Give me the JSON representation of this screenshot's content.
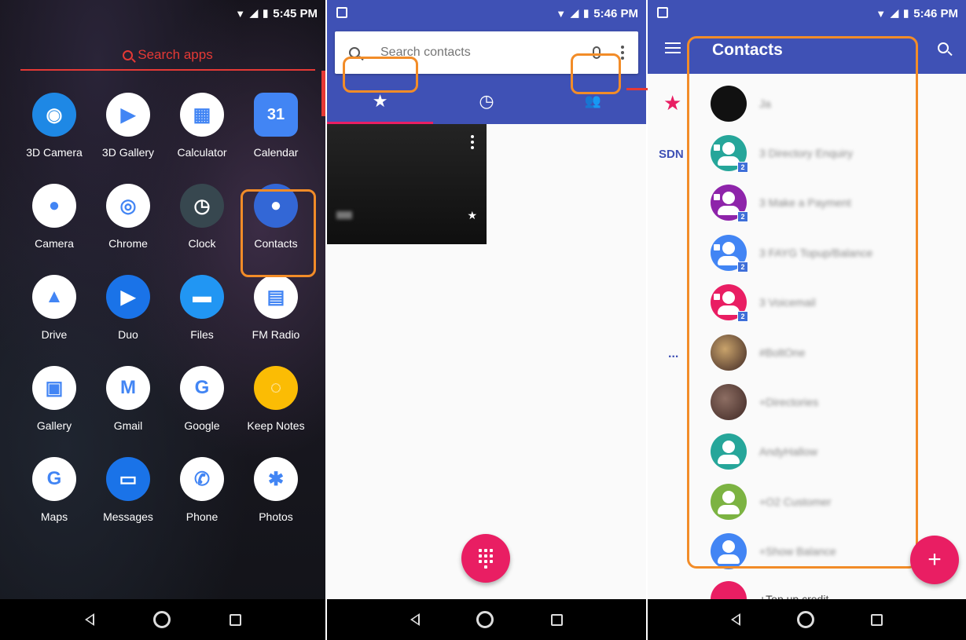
{
  "panel1": {
    "status_time": "5:45 PM",
    "search_label": "Search apps",
    "apps": [
      {
        "label": "3D Camera",
        "icon": "3d-camera-icon",
        "color": "#1e88e5",
        "glyph": "◉"
      },
      {
        "label": "3D Gallery",
        "icon": "3d-gallery-icon",
        "color": "#ffffff",
        "glyph": "▶"
      },
      {
        "label": "Calculator",
        "icon": "calculator-icon",
        "color": "#ffffff",
        "glyph": "▦"
      },
      {
        "label": "Calendar",
        "icon": "calendar-icon",
        "color": "#4285f4",
        "glyph": "31"
      },
      {
        "label": "Camera",
        "icon": "camera-icon",
        "color": "#ffffff",
        "glyph": "●"
      },
      {
        "label": "Chrome",
        "icon": "chrome-icon",
        "color": "#ffffff",
        "glyph": "◎"
      },
      {
        "label": "Clock",
        "icon": "clock-icon",
        "color": "#37474f",
        "glyph": "◷"
      },
      {
        "label": "Contacts",
        "icon": "contacts-icon",
        "color": "#3367d6",
        "glyph": "●"
      },
      {
        "label": "Drive",
        "icon": "drive-icon",
        "color": "#ffffff",
        "glyph": "▲"
      },
      {
        "label": "Duo",
        "icon": "duo-icon",
        "color": "#1a73e8",
        "glyph": "▶"
      },
      {
        "label": "Files",
        "icon": "files-icon",
        "color": "#2196f3",
        "glyph": "▬"
      },
      {
        "label": "FM Radio",
        "icon": "fm-radio-icon",
        "color": "#ffffff",
        "glyph": "▤"
      },
      {
        "label": "Gallery",
        "icon": "gallery-icon",
        "color": "#ffffff",
        "glyph": "▣"
      },
      {
        "label": "Gmail",
        "icon": "gmail-icon",
        "color": "#ffffff",
        "glyph": "M"
      },
      {
        "label": "Google",
        "icon": "google-icon",
        "color": "#ffffff",
        "glyph": "G"
      },
      {
        "label": "Keep Notes",
        "icon": "keep-notes-icon",
        "color": "#fbbc04",
        "glyph": "◌"
      },
      {
        "label": "Maps",
        "icon": "maps-icon",
        "color": "#ffffff",
        "glyph": "G"
      },
      {
        "label": "Messages",
        "icon": "messages-icon",
        "color": "#1a73e8",
        "glyph": "▭"
      },
      {
        "label": "Phone",
        "icon": "phone-icon",
        "color": "#ffffff",
        "glyph": "✆"
      },
      {
        "label": "Photos",
        "icon": "photos-icon",
        "color": "#ffffff",
        "glyph": "✱"
      }
    ]
  },
  "panel2": {
    "status_time": "5:46 PM",
    "search_placeholder": "Search contacts",
    "tabs": [
      {
        "icon": "star-icon",
        "glyph": "★"
      },
      {
        "icon": "clock-icon",
        "glyph": "◷"
      },
      {
        "icon": "people-icon",
        "glyph": "👥"
      }
    ],
    "favorite_name": "Ja"
  },
  "panel3": {
    "status_time": "5:46 PM",
    "title": "Contacts",
    "side_label": "SDN",
    "side_more": "...",
    "contacts": [
      {
        "name": "Ja",
        "color": "#111111",
        "type": "plain"
      },
      {
        "name": "3 Directory Enquiry",
        "color": "#26a69a",
        "type": "group",
        "badge": "2"
      },
      {
        "name": "3 Make a Payment",
        "color": "#8e24aa",
        "type": "group",
        "badge": "2"
      },
      {
        "name": "3 FAYG Topup/Balance",
        "color": "#4285f4",
        "type": "group",
        "badge": "2"
      },
      {
        "name": "3 Voicemail",
        "color": "#e91e63",
        "type": "group",
        "badge": "2"
      },
      {
        "name": "#BoltOne",
        "color": "#c9a36b",
        "type": "photo"
      },
      {
        "name": "+Directories",
        "color": "#8d6e63",
        "type": "photo"
      },
      {
        "name": "AndyHallow",
        "color": "#26a69a",
        "type": "person"
      },
      {
        "name": "+O2 Customer",
        "color": "#7cb342",
        "type": "person"
      },
      {
        "name": "+Show Balance",
        "color": "#4285f4",
        "type": "person"
      }
    ],
    "partial_contact": "+Top up credit",
    "fab_label": "+"
  },
  "accent_color": "#f28c28"
}
